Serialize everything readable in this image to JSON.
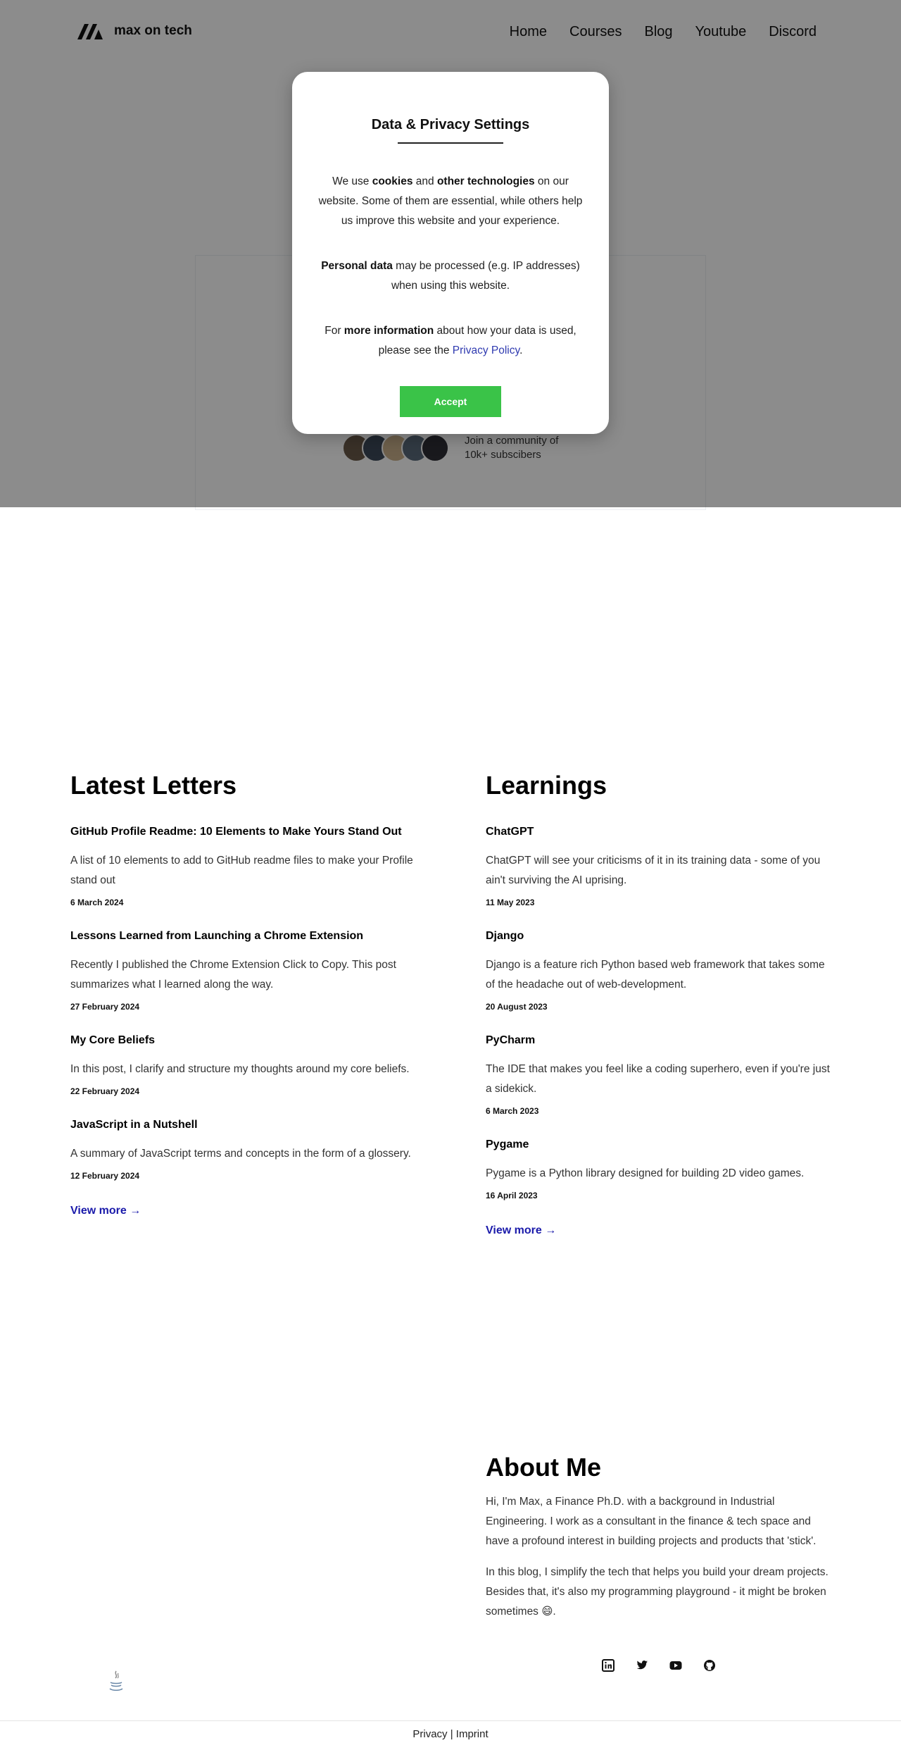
{
  "header": {
    "logo_text": "max on tech",
    "nav": [
      "Home",
      "Courses",
      "Blog",
      "Youtube",
      "Discord"
    ]
  },
  "hero": {
    "community_line1": "Join a community of",
    "community_line2": "10k+ subscibers"
  },
  "consent": {
    "title": "Data & Privacy Settings",
    "p1_a": "We use ",
    "p1_b": "cookies",
    "p1_c": " and ",
    "p1_d": "other technologies",
    "p1_e": " on our website. Some of them are essential, while others help us improve this website and your experience.",
    "p2_a": "Personal data",
    "p2_b": " may be processed (e.g. IP addresses) when using this website.",
    "p3_a": "For ",
    "p3_b": "more information",
    "p3_c": " about how your data is used, please see the ",
    "p3_link": "Privacy Policy",
    "p3_d": ".",
    "accept_label": "Accept"
  },
  "letters": {
    "title": "Latest Letters",
    "items": [
      {
        "title": "GitHub Profile Readme: 10 Elements to Make Yours Stand Out",
        "desc": "A list of 10 elements to add to GitHub readme files to make your Profile stand out",
        "date": "6 March 2024"
      },
      {
        "title": "Lessons Learned from Launching a Chrome Extension",
        "desc": "Recently I published the Chrome Extension Click to Copy. This post summarizes what I learned along the way.",
        "date": "27 February 2024"
      },
      {
        "title": "My Core Beliefs",
        "desc": "In this post, I clarify and structure my thoughts around my core beliefs.",
        "date": "22 February 2024"
      },
      {
        "title": "JavaScript in a Nutshell",
        "desc": "A summary of JavaScript terms and concepts in the form of a glossery.",
        "date": "12 February 2024"
      }
    ],
    "view_more": "View more →"
  },
  "learnings": {
    "title": "Learnings",
    "items": [
      {
        "title": "ChatGPT",
        "desc": "ChatGPT will see your criticisms of it in its training data - some of you ain't surviving the AI uprising.",
        "date": "11 May 2023"
      },
      {
        "title": "Django",
        "desc": "Django is a feature rich Python based web framework that takes some of the headache out of web-development.",
        "date": "20 August 2023"
      },
      {
        "title": "PyCharm",
        "desc": "The IDE that makes you feel like a coding superhero, even if you're just a sidekick.",
        "date": "6 March 2023"
      },
      {
        "title": "Pygame",
        "desc": "Pygame is a Python library designed for building 2D video games.",
        "date": "16 April 2023"
      }
    ],
    "view_more": "View more →"
  },
  "about": {
    "title": "About Me",
    "p1": "Hi, I'm Max, a Finance Ph.D. with a background in Industrial Engineering. I work as a consultant in the finance & tech space and have a profound interest in building projects and products that 'stick'.",
    "p2": "In this blog, I simplify the tech that helps you build your dream projects. Besides that, it's also my programming playground - it might be broken sometimes 😄.",
    "socials": [
      "linkedin-icon",
      "twitter-icon",
      "youtube-icon",
      "github-icon"
    ]
  },
  "footer": {
    "text": "Privacy | Imprint"
  },
  "colors": {
    "accept": "#3ac348",
    "link": "#1a1aaa",
    "overlay": "rgba(0,0,0,0.45)"
  }
}
